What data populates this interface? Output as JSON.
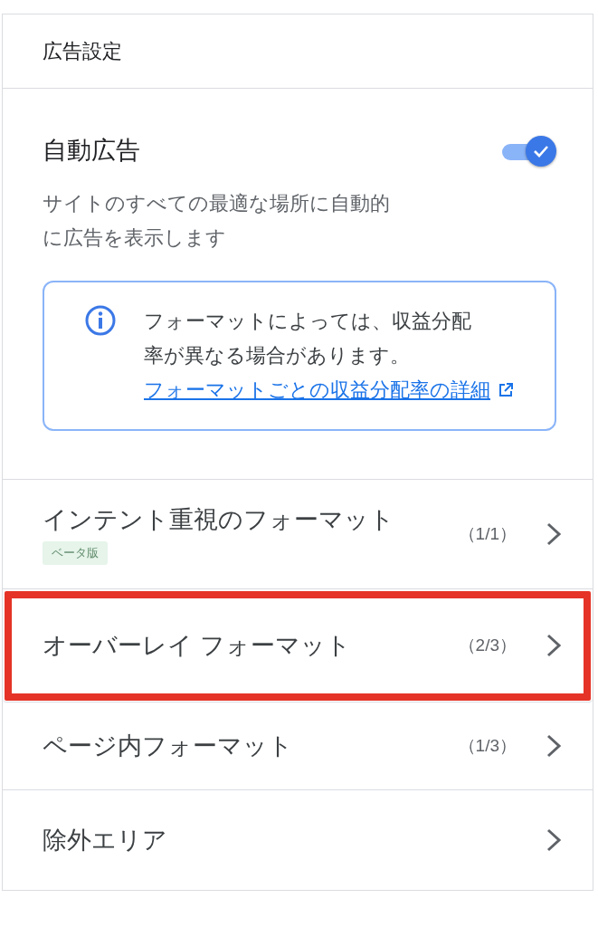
{
  "header": {
    "title": "広告設定"
  },
  "auto_ads": {
    "title": "自動広告",
    "on": true,
    "description": "サイトのすべての最適な場所に自動的に広告を表示します"
  },
  "notice": {
    "text": "フォーマットによっては、収益分配率が異なる場合があります。",
    "link": "フォーマットごとの収益分配率の詳細"
  },
  "formats": [
    {
      "label": "インテント重視のフォーマット",
      "badge": "ベータ版",
      "count": "（1/1）",
      "highlighted": false
    },
    {
      "label": "オーバーレイ フォーマット",
      "count": "（2/3）",
      "highlighted": true
    },
    {
      "label": "ページ内フォーマット",
      "count": "（1/3）",
      "highlighted": false
    },
    {
      "label": "除外エリア",
      "highlighted": false
    }
  ]
}
